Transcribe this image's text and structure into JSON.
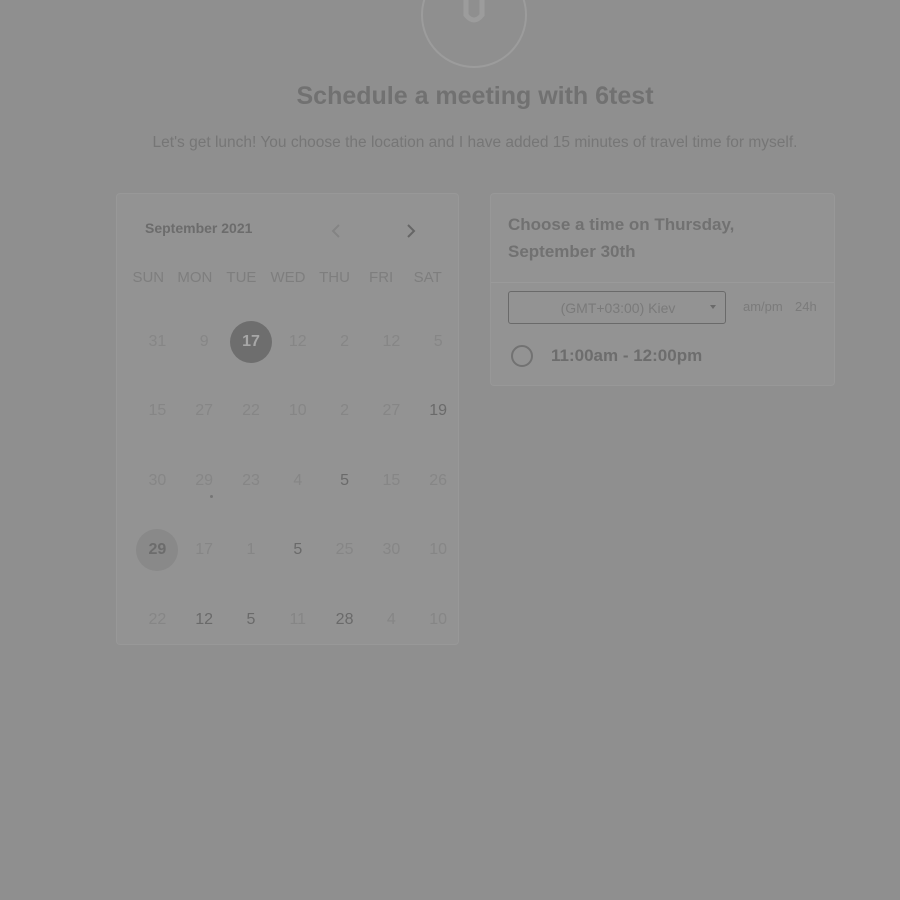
{
  "header": {
    "avatar_icon": "host-avatar-icon",
    "title": "Schedule a meeting with 6test",
    "description": "Let's get lunch! You choose the location and I have added 15 minutes of travel time for myself."
  },
  "calendar": {
    "month_label": "September 2021",
    "prev_icon": "chevron-left-icon",
    "next_icon": "chevron-right-icon",
    "weekdays": [
      "SUN",
      "MON",
      "TUE",
      "WED",
      "THU",
      "FRI",
      "SAT"
    ],
    "days": [
      {
        "label": "31",
        "state": "disabled"
      },
      {
        "label": "9",
        "state": "disabled"
      },
      {
        "label": "17",
        "state": "selected"
      },
      {
        "label": "12",
        "state": "disabled"
      },
      {
        "label": "2",
        "state": "disabled"
      },
      {
        "label": "12",
        "state": "disabled"
      },
      {
        "label": "5",
        "state": "disabled"
      },
      {
        "label": "15",
        "state": "disabled"
      },
      {
        "label": "27",
        "state": "disabled"
      },
      {
        "label": "22",
        "state": "disabled"
      },
      {
        "label": "10",
        "state": "disabled"
      },
      {
        "label": "2",
        "state": "disabled"
      },
      {
        "label": "27",
        "state": "disabled"
      },
      {
        "label": "19",
        "state": "active"
      },
      {
        "label": "30",
        "state": "disabled"
      },
      {
        "label": "29",
        "state": "disabled",
        "dot": true
      },
      {
        "label": "23",
        "state": "disabled"
      },
      {
        "label": "4",
        "state": "disabled"
      },
      {
        "label": "5",
        "state": "active"
      },
      {
        "label": "15",
        "state": "disabled"
      },
      {
        "label": "26",
        "state": "disabled"
      },
      {
        "label": "29",
        "state": "today"
      },
      {
        "label": "17",
        "state": "disabled"
      },
      {
        "label": "1",
        "state": "disabled"
      },
      {
        "label": "5",
        "state": "active"
      },
      {
        "label": "25",
        "state": "disabled"
      },
      {
        "label": "30",
        "state": "disabled"
      },
      {
        "label": "10",
        "state": "disabled"
      },
      {
        "label": "22",
        "state": "disabled"
      },
      {
        "label": "12",
        "state": "active"
      },
      {
        "label": "5",
        "state": "active"
      },
      {
        "label": "11",
        "state": "disabled"
      },
      {
        "label": "28",
        "state": "active"
      },
      {
        "label": "4",
        "state": "disabled"
      },
      {
        "label": "10",
        "state": "disabled"
      }
    ]
  },
  "times": {
    "heading": "Choose a time on Thursday, September 30th",
    "timezone": "(GMT+03:00) Kiev",
    "format_ampm": "am/pm",
    "format_24h": "24h",
    "slots": [
      {
        "label": "11:00am - 12:00pm"
      }
    ]
  }
}
